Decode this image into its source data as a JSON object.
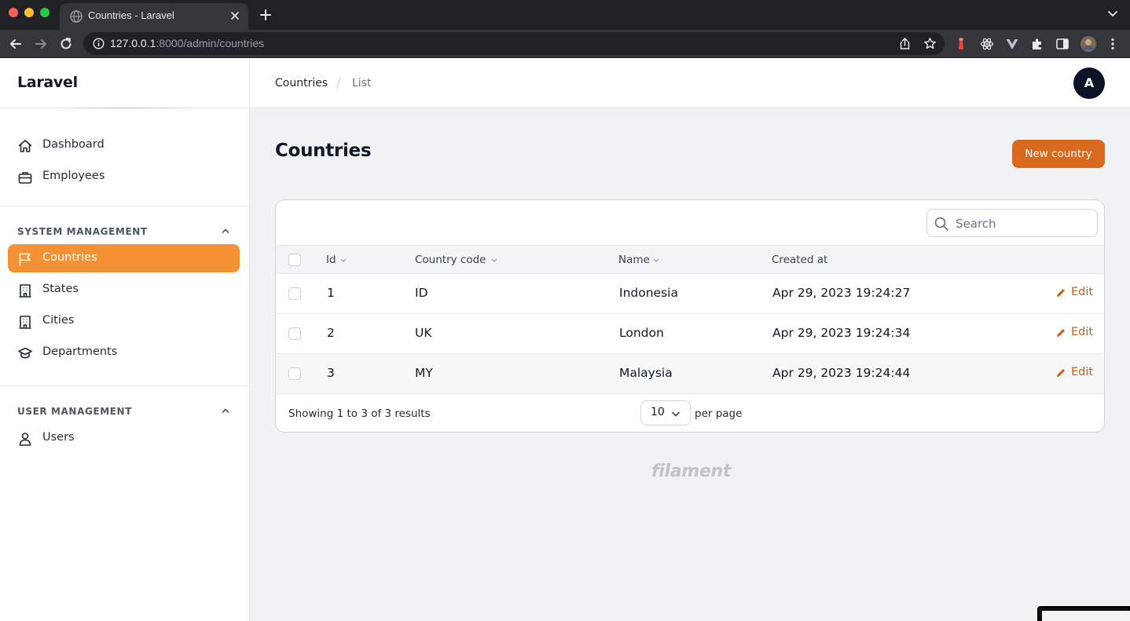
{
  "browser": {
    "tab_title": "Countries - Laravel",
    "url_host": "127.0.0.1",
    "url_path": ":8000/admin/countries"
  },
  "sidebar": {
    "brand": "Laravel",
    "items": [
      {
        "label": "Dashboard",
        "icon": "home-icon"
      },
      {
        "label": "Employees",
        "icon": "briefcase-icon"
      }
    ],
    "groups": [
      {
        "label": "SYSTEM MANAGEMENT",
        "items": [
          {
            "label": "Countries",
            "icon": "flag-icon",
            "active": true
          },
          {
            "label": "States",
            "icon": "building-icon"
          },
          {
            "label": "Cities",
            "icon": "building-icon"
          },
          {
            "label": "Departments",
            "icon": "academic-cap-icon"
          }
        ]
      },
      {
        "label": "USER MANAGEMENT",
        "items": [
          {
            "label": "Users",
            "icon": "user-icon"
          }
        ]
      }
    ],
    "accent_color": "#f59135"
  },
  "topbar": {
    "breadcrumb": [
      "Countries",
      "List"
    ],
    "avatar_initial": "A"
  },
  "main": {
    "title": "Countries",
    "new_button": "New country",
    "button_color": "#d9691f",
    "table": {
      "search_placeholder": "Search",
      "columns": [
        "Id",
        "Country code",
        "Name",
        "Created at"
      ],
      "rows": [
        {
          "id": "1",
          "code": "ID",
          "name": "Indonesia",
          "created_at": "Apr 29, 2023 19:24:27",
          "action": "Edit"
        },
        {
          "id": "2",
          "code": "UK",
          "name": "London",
          "created_at": "Apr 29, 2023 19:24:34",
          "action": "Edit"
        },
        {
          "id": "3",
          "code": "MY",
          "name": "Malaysia",
          "created_at": "Apr 29, 2023 19:24:44",
          "action": "Edit"
        }
      ],
      "summary": "Showing 1 to 3 of 3 results",
      "per_page_value": "10",
      "per_page_label": "per page"
    },
    "footer_brand": "filament"
  }
}
